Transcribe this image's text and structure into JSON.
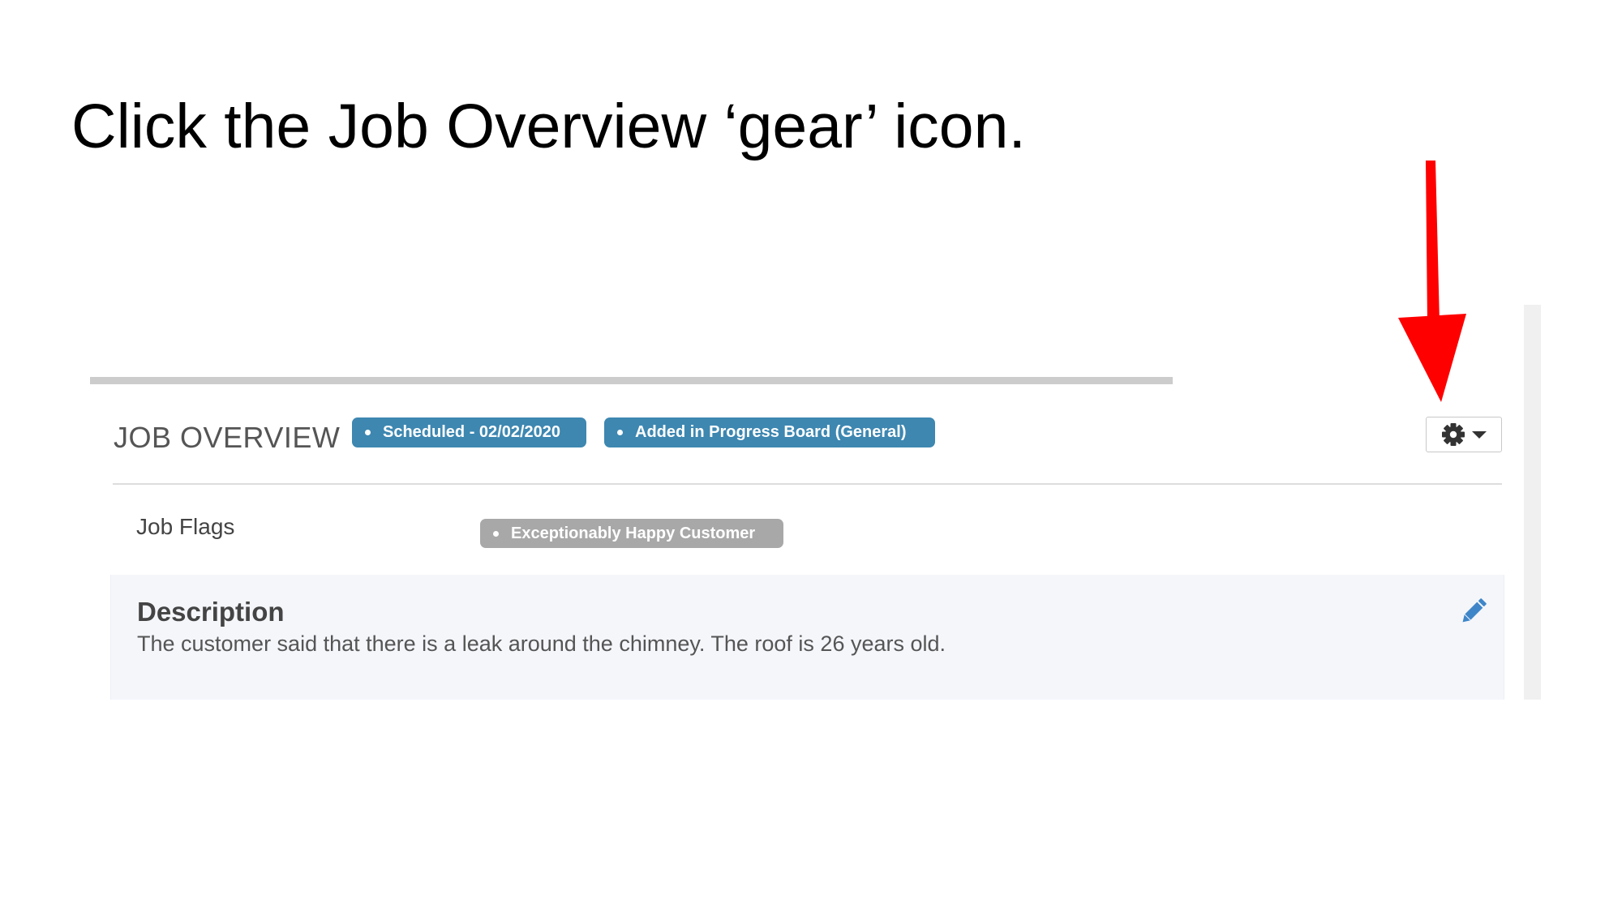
{
  "instruction": "Click the Job Overview ‘gear’ icon.",
  "job_overview": {
    "title": "JOB OVERVIEW",
    "badges": [
      {
        "label": "Scheduled - 02/02/2020",
        "color": "#3d87b1"
      },
      {
        "label": "Added in Progress Board (General)",
        "color": "#3d87b1"
      }
    ],
    "settings_button": {
      "icon": "gear-icon",
      "caret_icon": "caret-down-icon"
    }
  },
  "job_flags": {
    "label": "Job Flags",
    "flags": [
      {
        "label": "Exceptionably Happy Customer",
        "color": "#a8a8a8"
      }
    ]
  },
  "description": {
    "title": "Description",
    "text": "The customer said that there is a leak around the chimney.  The roof is 26 years old.",
    "edit_icon": "pencil-icon"
  },
  "annotation": {
    "type": "arrow",
    "color": "#ff0000"
  }
}
